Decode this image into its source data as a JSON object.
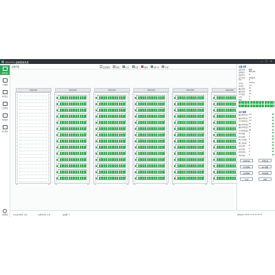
{
  "titlebar": {
    "title": "ECS-PCS 组串配置系统",
    "controls": {
      "minimize": "—",
      "maximize": "□",
      "close": "×"
    }
  },
  "sidebar": {
    "items": [
      {
        "label": "系统总览",
        "icon": "overview-icon",
        "active": true
      },
      {
        "label": "工况数据",
        "icon": "chart-icon"
      },
      {
        "label": "实时监控",
        "icon": "monitor-icon"
      },
      {
        "label": "历史数据",
        "icon": "history-icon"
      },
      {
        "label": "系统设置",
        "icon": "settings-icon"
      },
      {
        "label": "用户管理",
        "icon": "user-icon"
      }
    ],
    "bottom": {
      "label": "系统管理",
      "icon": "admin-icon"
    }
  },
  "main": {
    "header_title": "设备列表",
    "legend": [
      {
        "label": "设备图例",
        "color": "#ffffff"
      },
      {
        "label": "离线",
        "color": "#bfc5ca"
      },
      {
        "label": "正常",
        "color": "#3bbf60"
      },
      {
        "label": "告警",
        "color": "#f0a020"
      },
      {
        "label": "故障",
        "color": "#e04040"
      },
      {
        "label": "运行中",
        "color": "#2fa85c"
      },
      {
        "label": "待机",
        "color": "#7aa7d8"
      }
    ],
    "racks": [
      {
        "name": "RACK-001",
        "modules": 0,
        "foot_left": "0%",
        "foot_right": "0%"
      },
      {
        "name": "RACK-002",
        "modules": 14,
        "foot_left": "0%",
        "foot_right": "0%"
      },
      {
        "name": "RACK-003",
        "modules": 14,
        "foot_left": "0%",
        "foot_right": "0%"
      },
      {
        "name": "RACK-004",
        "modules": 14,
        "foot_left": "0%",
        "foot_right": "0%"
      },
      {
        "name": "RACK-005",
        "modules": 14,
        "foot_left": "0%",
        "foot_right": "0%"
      },
      {
        "name": "RACK-006",
        "modules": 14,
        "foot_left": "0%",
        "foot_right": "0%"
      }
    ]
  },
  "right_panel": {
    "info_title": "设备详情",
    "info": [
      {
        "k": "设备名称:",
        "v": "储能"
      },
      {
        "k": "设备编号:",
        "v": "001-001"
      },
      {
        "k": "设备型号:",
        "v": "A"
      },
      {
        "k": "运行状态:",
        "v": "当前运行"
      },
      {
        "k": "SOC:",
        "v": "0"
      },
      {
        "k": "总电压:",
        "v": "475.8 V"
      },
      {
        "k": "总电流:",
        "v": "0 A"
      },
      {
        "k": "最高温度:",
        "v": "25"
      },
      {
        "k": "最低温度:",
        "v": "24"
      },
      {
        "k": "平均温度:",
        "v": "24"
      },
      {
        "k": "功率:",
        "v": "0"
      },
      {
        "k": "能量:",
        "v": "0"
      }
    ],
    "param_title": "运行参数",
    "params": [
      {
        "k": "最高单体电压:",
        "v": "3.3"
      },
      {
        "k": "最低单体电压:",
        "v": "3.2"
      },
      {
        "k": "平均单体电压:",
        "v": "3.2"
      },
      {
        "k": "最高单体温度:",
        "v": "25"
      },
      {
        "k": "最低单体温度:",
        "v": "24"
      },
      {
        "k": "平均单体温度:",
        "v": "24"
      },
      {
        "k": "充电电量:",
        "v": "0"
      },
      {
        "k": "放电电量:",
        "v": "0"
      },
      {
        "k": "累计充电量:",
        "v": "0"
      },
      {
        "k": "累计放电量:",
        "v": "0"
      },
      {
        "k": "充电次数:",
        "v": "0"
      },
      {
        "k": "放电次数:",
        "v": "0"
      },
      {
        "k": "绝缘电阻+:",
        "v": "0"
      },
      {
        "k": "绝缘电阻-:",
        "v": "0"
      }
    ],
    "buttons": [
      "电池信息",
      "告警信息",
      "历史数据",
      "运行参数",
      "实时数据",
      "系统参数",
      "启动",
      "停机"
    ]
  },
  "statusbar": {
    "items": [
      "总运行模式: 正常",
      "通信状态: 正常",
      "设备数: 6",
      "系统时间: 2023-11-30 15:30:21"
    ]
  }
}
